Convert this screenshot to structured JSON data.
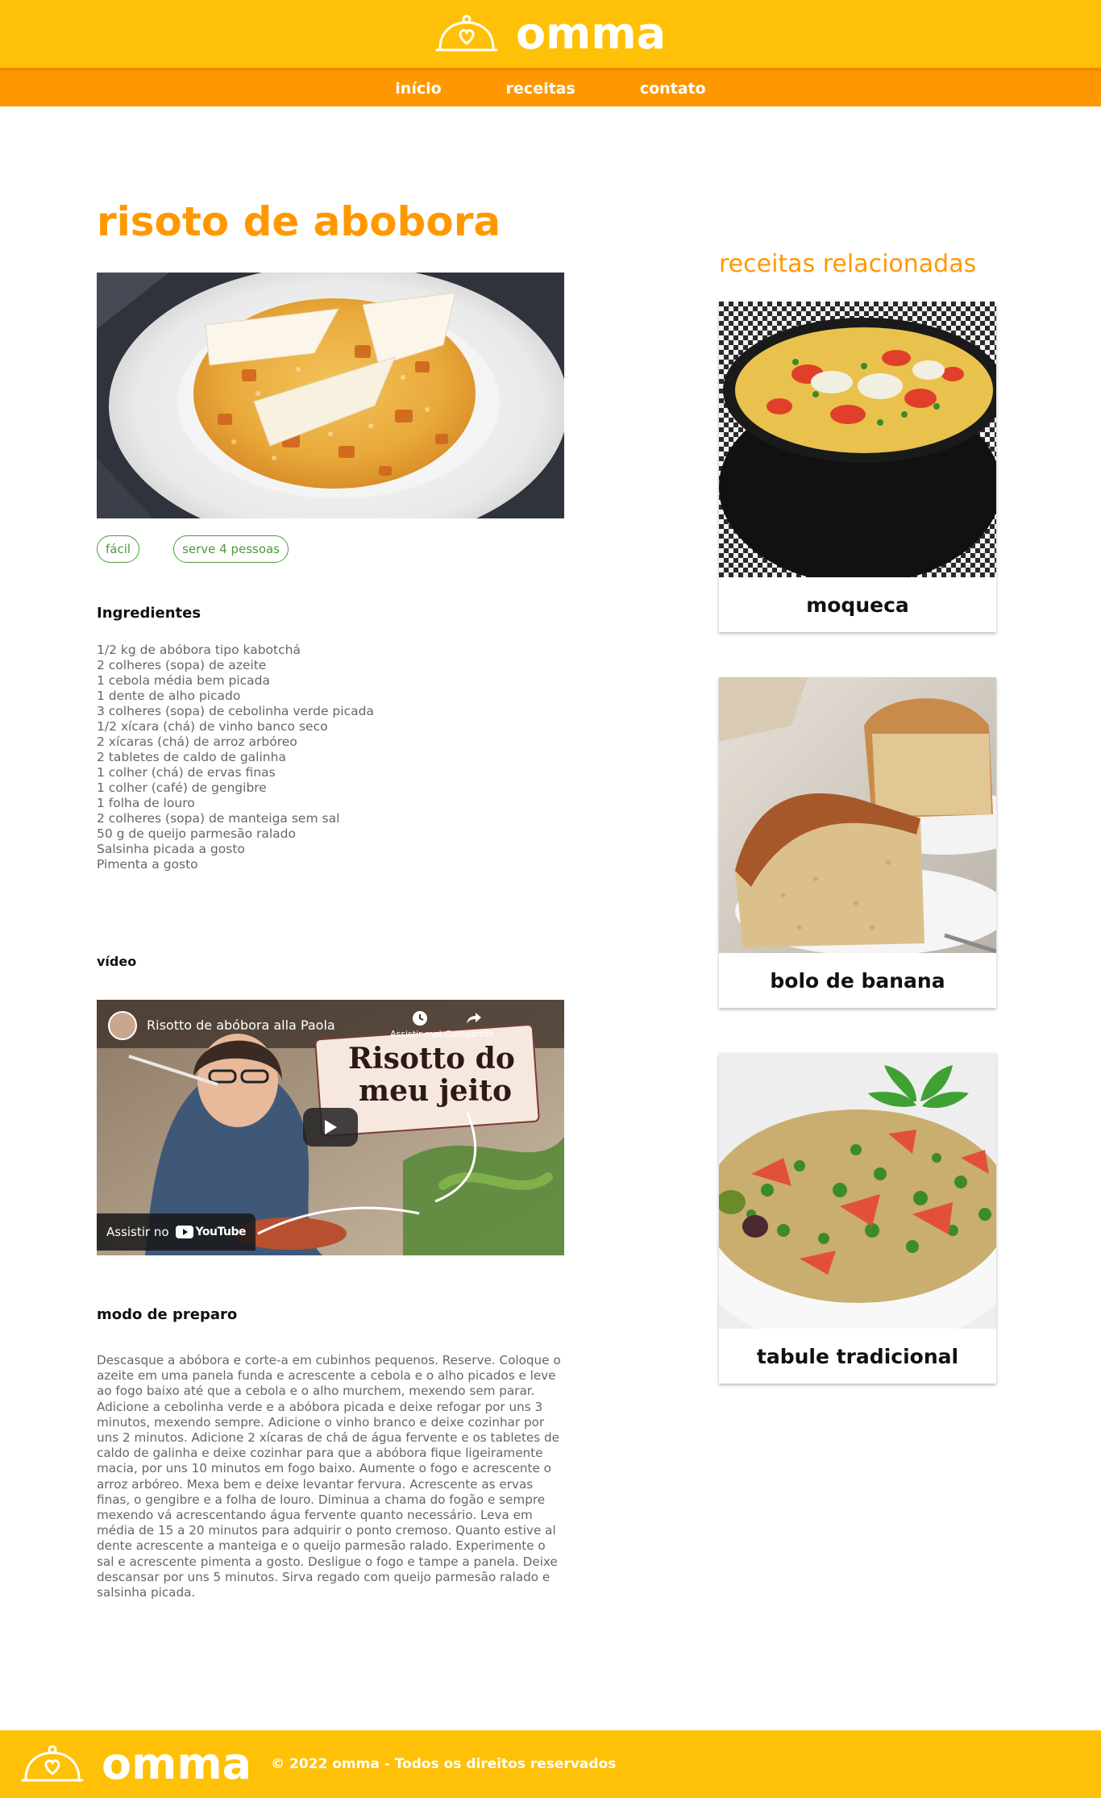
{
  "header": {
    "logo_text": "omma",
    "nav": [
      {
        "label": "início"
      },
      {
        "label": "receitas"
      },
      {
        "label": "contato"
      }
    ]
  },
  "recipe": {
    "title": "risoto de abobora",
    "tags": [
      "fácil",
      "serve 4 pessoas"
    ],
    "ingredients_heading": "Ingredientes",
    "ingredients": [
      "1/2 kg de abóbora tipo kabotchá",
      "2 colheres (sopa) de azeite",
      "1 cebola média bem picada",
      "1 dente de alho picado",
      "3 colheres (sopa) de cebolinha verde picada",
      "1/2 xícara (chá) de vinho banco seco",
      "2 xícaras (chá) de arroz arbóreo",
      "2 tabletes de caldo de galinha",
      "1 colher (chá) de ervas finas",
      "1 colher (café) de gengibre",
      "1 folha de louro",
      "2 colheres (sopa) de manteiga sem sal",
      "50 g de queijo parmesão ralado",
      "Salsinha picada a gosto",
      "Pimenta a gosto"
    ],
    "video_heading": "vídeo",
    "video": {
      "title": "Risotto de abóbora alla Paola",
      "overlay_text_line1": "Risotto do",
      "overlay_text_line2": "meu jeito",
      "watch_later": "Assistir mai...",
      "share": "Compartilh...",
      "watch_on": "Assistir no",
      "youtube": "YouTube"
    },
    "prep_heading": "modo de preparo",
    "prep_text": "Descasque a abóbora e corte-a em cubinhos pequenos. Reserve. Coloque o azeite em uma panela funda e acrescente a cebola e o alho picados e leve ao fogo baixo até que a cebola e o alho murchem, mexendo sem parar. Adicione a cebolinha verde e a abóbora picada e deixe refogar por uns 3 minutos, mexendo sempre. Adicione o vinho branco e deixe cozinhar por uns 2 minutos. Adicione 2 xícaras de chá de água fervente e os tabletes de caldo de galinha e deixe cozinhar para que a abóbora fique ligeiramente macia, por uns 10 minutos em fogo baixo. Aumente o fogo e acrescente o arroz arbóreo. Mexa bem e deixe levantar fervura. Acrescente as ervas finas, o gengibre e a folha de louro. Diminua a chama do fogão e sempre mexendo vá acrescentando água fervente quanto necessário. Leva em média de 15 a 20 minutos para adquirir o ponto cremoso. Quanto estive al dente acrescente a manteiga e o queijo parmesão ralado. Experimente o sal e acrescente pimenta a gosto. Desligue o fogo e tampe a panela. Deixe descansar por uns 5 minutos. Sirva regado com queijo parmesão ralado e salsinha picada."
  },
  "related": {
    "heading": "receitas relacionadas",
    "items": [
      {
        "title": "moqueca"
      },
      {
        "title": "bolo de banana"
      },
      {
        "title": "tabule tradicional"
      }
    ]
  },
  "footer": {
    "logo_text": "omma",
    "copyright": "© 2022 omma - Todos os direitos reservados"
  },
  "colors": {
    "header_yellow": "#FFC107",
    "nav_orange": "#FF9800",
    "title_orange": "#FF9800",
    "tag_green": "#4C9A3C",
    "body_text": "#666666"
  },
  "icons": [
    "cloche-heart-icon",
    "clock-icon",
    "share-icon",
    "play-icon",
    "youtube-logo-icon"
  ]
}
